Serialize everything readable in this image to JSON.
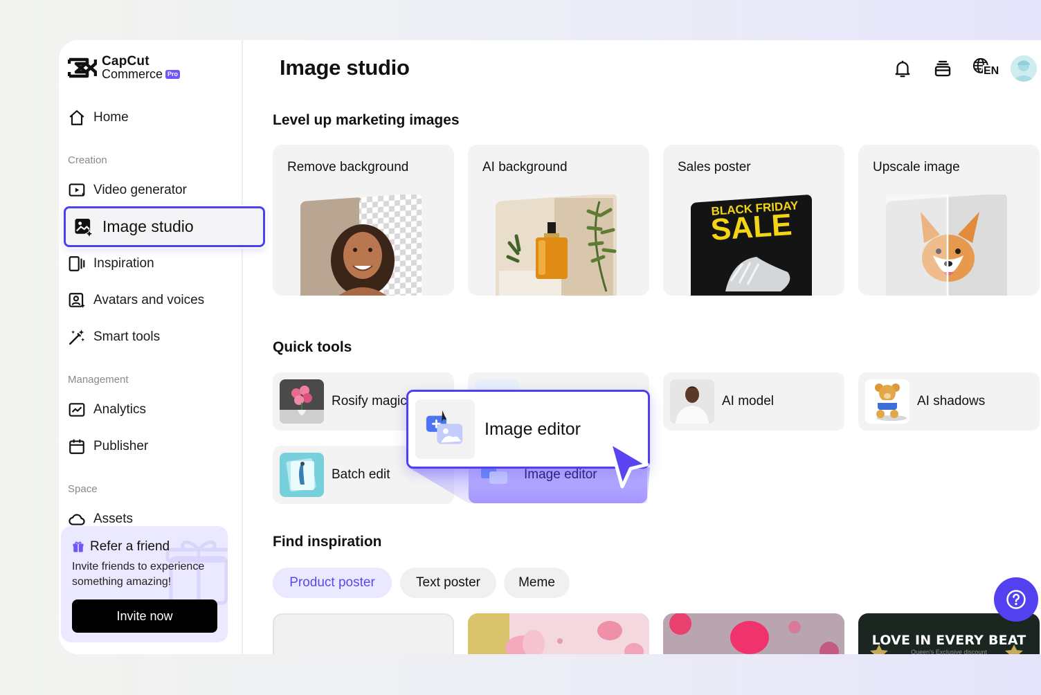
{
  "brand": {
    "line1": "CapCut",
    "line2": "Commerce",
    "badge": "Pro"
  },
  "sidebar": {
    "home": "Home",
    "sections": {
      "creation": "Creation",
      "management": "Management",
      "space": "Space"
    },
    "items": {
      "video_generator": "Video generator",
      "image_studio": "Image studio",
      "inspiration": "Inspiration",
      "avatars": "Avatars and voices",
      "smart_tools": "Smart tools",
      "analytics": "Analytics",
      "publisher": "Publisher",
      "assets": "Assets"
    },
    "refer": {
      "title": "Refer a friend",
      "description": "Invite friends to experience something amazing!",
      "button": "Invite now"
    }
  },
  "header": {
    "title": "Image studio",
    "language": "EN"
  },
  "marketing": {
    "title": "Level up marketing images",
    "cards": [
      {
        "label": "Remove background",
        "icon": "woman-portrait-cutout"
      },
      {
        "label": "AI background",
        "icon": "perfume-bottle"
      },
      {
        "label": "Sales poster",
        "icon": "sneaker-poster",
        "poster_line1": "BLACK FRIDAY",
        "poster_line2": "SALE"
      },
      {
        "label": "Upscale image",
        "icon": "corgi-photo"
      }
    ]
  },
  "quick_tools": {
    "title": "Quick tools",
    "items": [
      {
        "label": "Rosify magic",
        "icon": "rose-vase"
      },
      {
        "label": "Image editor",
        "icon": "image-editor"
      },
      {
        "label": "AI model",
        "icon": "model-person"
      },
      {
        "label": "AI shadows",
        "icon": "teddy-bear"
      },
      {
        "label": "Batch edit",
        "icon": "photo-stack"
      }
    ],
    "popup_label": "Image editor"
  },
  "inspiration": {
    "title": "Find inspiration",
    "tabs": [
      "Product poster",
      "Text poster",
      "Meme"
    ],
    "active_tab": "Product poster",
    "card4_text": "LOVE IN EVERY BEAT",
    "card4_subtext": "Queen's Exclusive discount"
  },
  "colors": {
    "accent": "#4f3ff0",
    "help": "#5340f0",
    "tab_active_bg": "#ebe9ff"
  }
}
